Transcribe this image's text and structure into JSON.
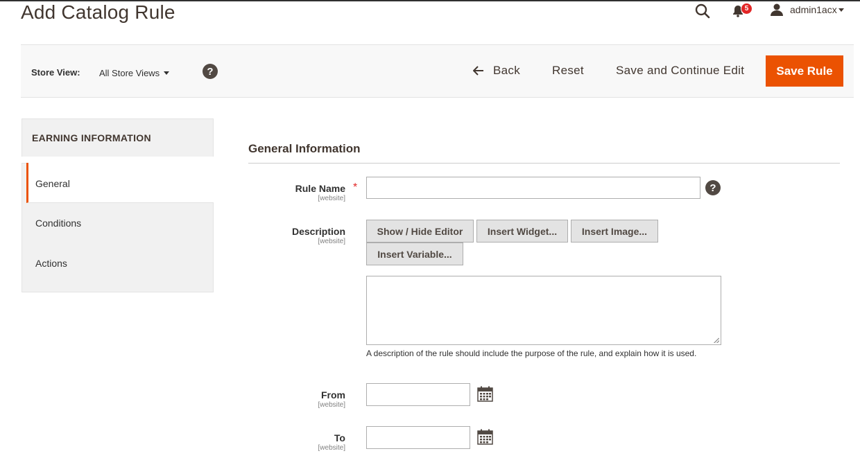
{
  "page": {
    "title": "Add Catalog Rule"
  },
  "header": {
    "notification_count": "5",
    "user_name": "admin1acx"
  },
  "toolbar": {
    "store_view_label": "Store View:",
    "store_view_value": "All Store Views",
    "back_label": "Back",
    "reset_label": "Reset",
    "save_continue_label": "Save and Continue Edit",
    "save_rule_label": "Save Rule"
  },
  "sidebar": {
    "heading": "EARNING INFORMATION",
    "items": [
      {
        "label": "General",
        "active": true
      },
      {
        "label": "Conditions",
        "active": false
      },
      {
        "label": "Actions",
        "active": false
      }
    ]
  },
  "form": {
    "section_title": "General Information",
    "rule_name": {
      "label": "Rule Name",
      "scope": "[website]",
      "required_mark": "*",
      "value": ""
    },
    "description": {
      "label": "Description",
      "scope": "[website]",
      "buttons": [
        "Show / Hide Editor",
        "Insert Widget...",
        "Insert Image...",
        "Insert Variable..."
      ],
      "value": "",
      "note": "A description of the rule should include the purpose of the rule, and explain how it is used."
    },
    "from": {
      "label": "From",
      "scope": "[website]",
      "value": ""
    },
    "to": {
      "label": "To",
      "scope": "[website]",
      "value": ""
    }
  },
  "colors": {
    "accent": "#eb5202",
    "badge": "#e22626",
    "title_text": "#41362f",
    "button_grey": "#e3e3e3"
  },
  "icons": [
    "search-icon",
    "bell-icon",
    "user-icon",
    "help-icon",
    "back-arrow-icon",
    "calendar-icon"
  ]
}
